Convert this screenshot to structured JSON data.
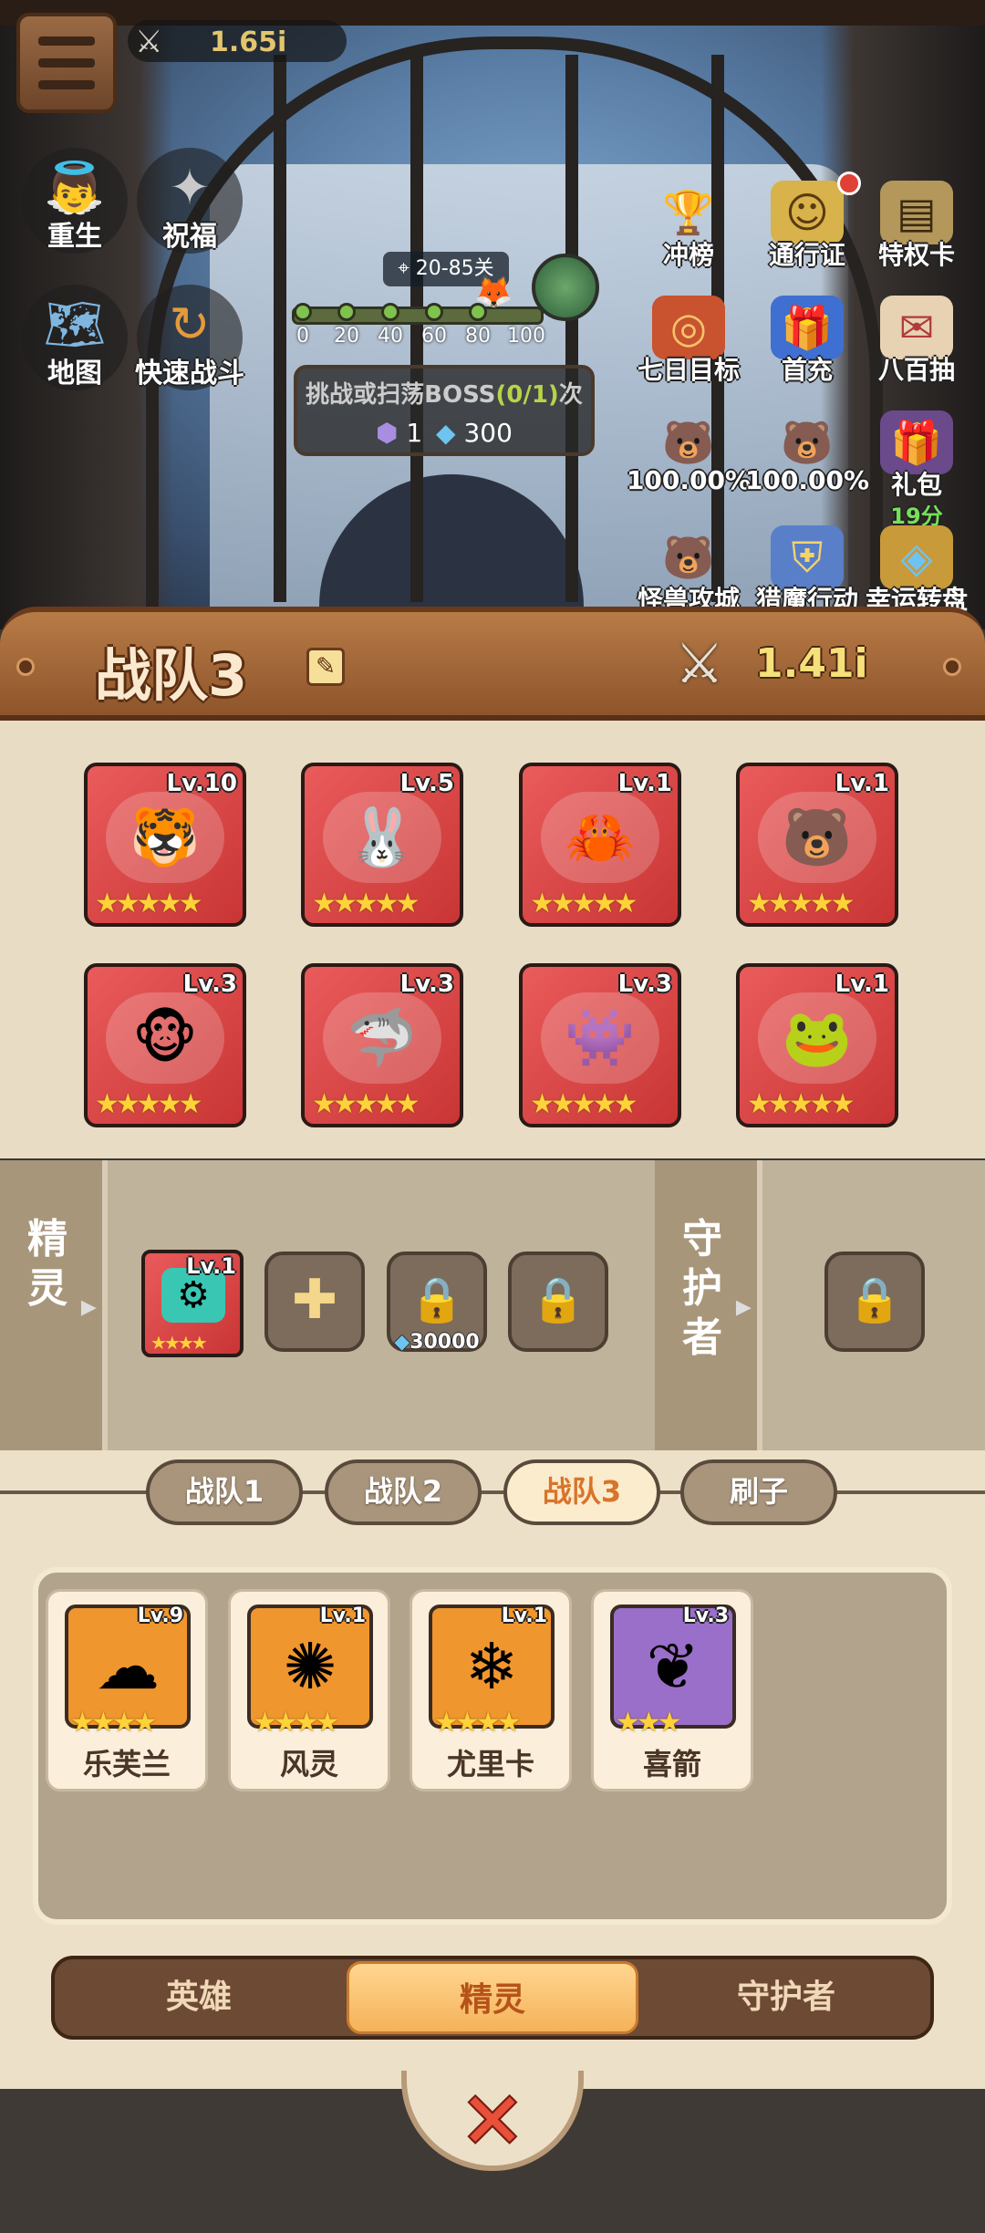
{
  "hud": {
    "power": "1.65i",
    "left_buttons": [
      {
        "label": "重生",
        "icon": "angel-icon"
      },
      {
        "label": "祝福",
        "icon": "blessing-icon"
      },
      {
        "label": "地图",
        "icon": "map-icon"
      },
      {
        "label": "快速战斗",
        "icon": "fast-battle-icon"
      }
    ],
    "stage": "20-85关",
    "progress_ticks": [
      "0",
      "20",
      "40",
      "60",
      "80",
      "100"
    ],
    "boss_text_before": "挑战或扫荡BOSS",
    "boss_count": "(0/1)",
    "boss_text_after": "次",
    "boss_energy_cost": "1",
    "boss_gem_cost": "300",
    "right_icons": [
      {
        "label": "冲榜",
        "icon": "trophy-icon"
      },
      {
        "label": "通行证",
        "icon": "pass-icon"
      },
      {
        "label": "特权卡",
        "icon": "privilege-card-icon"
      },
      {
        "label": "七日目标",
        "icon": "seven-day-target-icon"
      },
      {
        "label": "首充",
        "icon": "first-recharge-icon"
      },
      {
        "label": "八百抽",
        "icon": "800-draw-icon"
      },
      {
        "label": "100.00%",
        "icon": "bear-reward-icon"
      },
      {
        "label": "100.00%",
        "icon": "bear-reward-icon"
      },
      {
        "label": "礼包",
        "icon": "gift-pack-icon",
        "sub": "19分"
      },
      {
        "label": "怪兽攻城",
        "icon": "monster-siege-icon"
      },
      {
        "label": "猎魔行动",
        "icon": "demon-hunt-icon"
      },
      {
        "label": "幸运转盘",
        "icon": "lucky-wheel-icon"
      }
    ]
  },
  "team": {
    "title": "战队3",
    "power": "1.41i"
  },
  "heroes": [
    {
      "level": "Lv.10",
      "icon": "tiger-icon",
      "stars": 5
    },
    {
      "level": "Lv.5",
      "icon": "bunny-hat-kid-icon",
      "stars": 5
    },
    {
      "level": "Lv.1",
      "icon": "crab-icon",
      "stars": 5
    },
    {
      "level": "Lv.1",
      "icon": "polar-bear-icon",
      "stars": 5
    },
    {
      "level": "Lv.3",
      "icon": "monkey-king-icon",
      "stars": 5
    },
    {
      "level": "Lv.3",
      "icon": "shark-pirate-icon",
      "stars": 5
    },
    {
      "level": "Lv.3",
      "icon": "hooded-reaper-icon",
      "stars": 5
    },
    {
      "level": "Lv.1",
      "icon": "toad-icon",
      "stars": 5
    }
  ],
  "spirit_row": {
    "label": "精灵",
    "equipped": {
      "level": "Lv.1",
      "icon": "cyan-robot-icon",
      "stars": 4
    },
    "unlock_cost": "30000",
    "guardian_label": "守护者"
  },
  "team_tabs": [
    "战队1",
    "战队2",
    "战队3",
    "刷子"
  ],
  "active_team_tab": "战队3",
  "pool": [
    {
      "name": "乐芙兰",
      "level": "Lv.9",
      "icon": "cloud-spirit-icon",
      "stars": 4,
      "bg": "#f0962e"
    },
    {
      "name": "风灵",
      "level": "Lv.1",
      "icon": "wind-spirit-icon",
      "stars": 4,
      "bg": "#f0962e"
    },
    {
      "name": "尤里卡",
      "level": "Lv.1",
      "icon": "ice-spirit-icon",
      "stars": 4,
      "bg": "#f0962e"
    },
    {
      "name": "喜箭",
      "level": "Lv.3",
      "icon": "ghost-arrow-icon",
      "stars": 3,
      "bg": "#9a6fc9"
    }
  ],
  "segment": {
    "items": [
      "英雄",
      "精灵",
      "守护者"
    ],
    "active": "精灵"
  },
  "colors": {
    "hero_card": "#d94545",
    "accent_orange": "#f5b259",
    "power_gold": "#f5e07a",
    "wood": "#a66a3b"
  }
}
